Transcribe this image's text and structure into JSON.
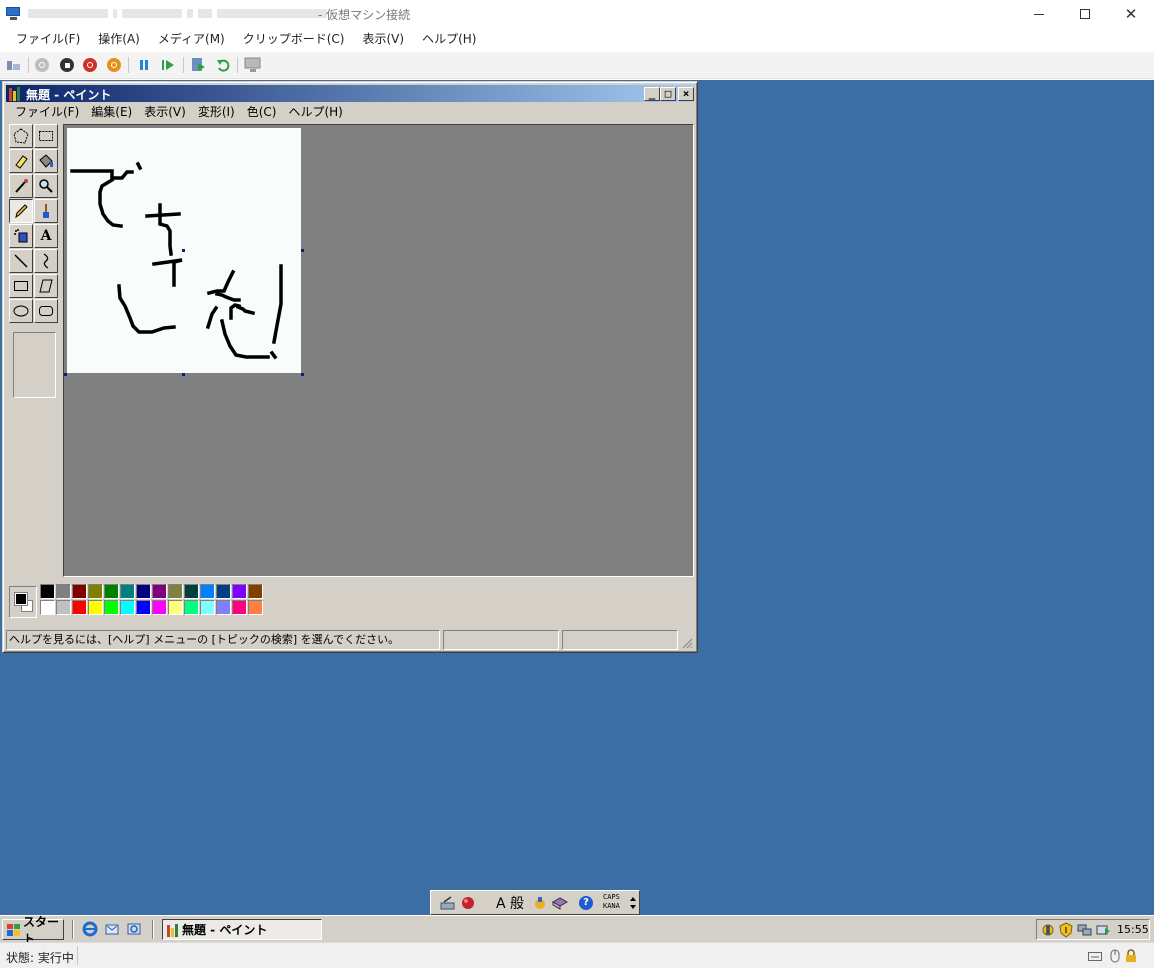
{
  "host": {
    "title_suffix": "- 仮想マシン接続",
    "menu": [
      "ファイル(F)",
      "操作(A)",
      "メディア(M)",
      "クリップボード(C)",
      "表示(V)",
      "ヘルプ(H)"
    ],
    "minimize_glyph": "—",
    "close_glyph": "✕",
    "status_text": "状態: 実行中"
  },
  "paint": {
    "title": "無題 - ペイント",
    "menu": [
      "ファイル(F)",
      "編集(E)",
      "表示(V)",
      "変形(I)",
      "色(C)",
      "ヘルプ(H)"
    ],
    "title_buttons": [
      "_",
      "□",
      "×"
    ],
    "status_help": "ヘルプを見るには、[ヘルプ] メニューの [トピックの検索] を選んでください。",
    "palette_top": [
      "#000000",
      "#808080",
      "#800000",
      "#808000",
      "#008000",
      "#008080",
      "#000080",
      "#800080",
      "#808040",
      "#004040",
      "#0080ff",
      "#004080",
      "#8000ff",
      "#804000"
    ],
    "palette_bottom": [
      "#ffffff",
      "#c0c0c0",
      "#ff0000",
      "#ffff00",
      "#00ff00",
      "#00ffff",
      "#0000ff",
      "#ff00ff",
      "#ffff80",
      "#00ff80",
      "#80ffff",
      "#8080ff",
      "#ff0080",
      "#ff8040"
    ],
    "foreground_color": "#000000",
    "background_color": "#ffffff"
  },
  "ime": {
    "mode_text": "A 般",
    "help_glyph": "?",
    "caps_label": "CAPS",
    "kana_label": "KANA"
  },
  "taskbar": {
    "start_label": "スタート",
    "task_label": "無題 - ペイント",
    "clock": "15:55"
  }
}
